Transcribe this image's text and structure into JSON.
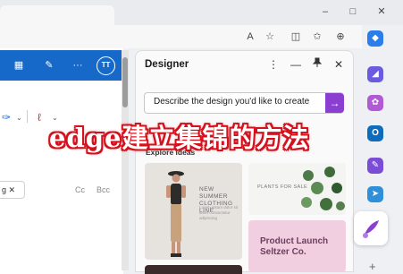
{
  "browser": {
    "toolbar_icons": [
      "read-aloud-icon",
      "favorite-add-icon",
      "split-screen-icon",
      "favorites-icon",
      "collections-icon",
      "more-icon"
    ],
    "window_buttons": {
      "minimize": "–",
      "maximize": "□",
      "close": "✕"
    }
  },
  "outlook": {
    "ribbon_icons": [
      "word-icon",
      "edit-icon",
      "more-icon"
    ],
    "more_label": "···",
    "avatar_initials": "TT",
    "recipient_chip": "g",
    "cc_label": "Cc",
    "bcc_label": "Bcc"
  },
  "designer": {
    "title": "Designer",
    "more_label": "⋮",
    "minimize_label": "—",
    "pin_label": "📌",
    "close_label": "✕",
    "prompt_placeholder": "Describe the design you'd like to create",
    "send_label": "→",
    "explore_label": "Explore ideas",
    "cards": [
      {
        "title": "NEW SUMMER CLOTHING LINE",
        "subtitle": "Lorem ipsum dolor sit amet consectetur adipiscing"
      },
      {
        "title": "PLANTS FOR SALE"
      },
      {
        "title": "Product Launch Seltzer Co."
      }
    ]
  },
  "sidebar": {
    "icons": [
      "copilot-icon",
      "tag-icon",
      "copilot-small-icon",
      "outlook-icon",
      "games-icon",
      "send-icon",
      "designer-icon"
    ],
    "add_label": "+"
  },
  "overlay": {
    "caption": "edge建立集锦的方法"
  },
  "colors": {
    "ribbon": "#1669c9",
    "accent": "#8a3fd1",
    "caption_stroke": "#d4121e"
  }
}
